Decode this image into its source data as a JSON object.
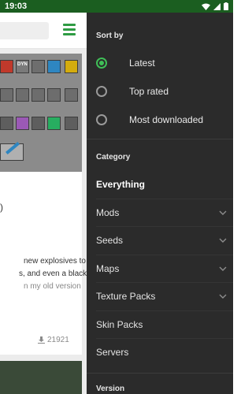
{
  "status_bar": {
    "time": "19:03"
  },
  "background_page": {
    "text_lines": [
      "new explosives to",
      "s, and even a black",
      "n my old version"
    ],
    "download_count": "21921",
    "fragment_char": ")",
    "thumb_label": "DYN"
  },
  "drawer": {
    "sort_by": {
      "title": "Sort by",
      "options": [
        {
          "label": "Latest",
          "checked": true
        },
        {
          "label": "Top rated",
          "checked": false
        },
        {
          "label": "Most downloaded",
          "checked": false
        }
      ]
    },
    "category": {
      "title": "Category",
      "items": [
        {
          "label": "Everything",
          "selected": true,
          "expandable": false
        },
        {
          "label": "Mods",
          "selected": false,
          "expandable": true
        },
        {
          "label": "Seeds",
          "selected": false,
          "expandable": true
        },
        {
          "label": "Maps",
          "selected": false,
          "expandable": true
        },
        {
          "label": "Texture Packs",
          "selected": false,
          "expandable": true
        },
        {
          "label": "Skin Packs",
          "selected": false,
          "expandable": false
        },
        {
          "label": "Servers",
          "selected": false,
          "expandable": false
        }
      ]
    },
    "version": {
      "title": "Version"
    }
  },
  "colors": {
    "status_bar": "#1b5e20",
    "drawer_bg": "#2b2b2b",
    "accent_green": "#3fbf57"
  }
}
